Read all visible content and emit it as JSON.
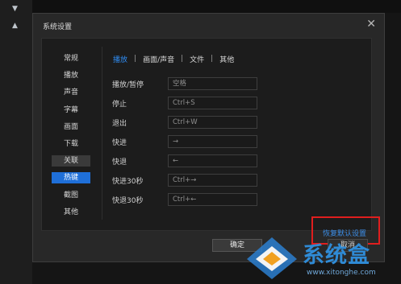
{
  "dialog": {
    "title": "系统设置",
    "close_glyph": "✕"
  },
  "nav": {
    "items": [
      {
        "label": "常规",
        "state": "normal"
      },
      {
        "label": "播放",
        "state": "normal"
      },
      {
        "label": "声音",
        "state": "normal"
      },
      {
        "label": "字幕",
        "state": "normal"
      },
      {
        "label": "画面",
        "state": "normal"
      },
      {
        "label": "下载",
        "state": "normal"
      },
      {
        "label": "关联",
        "state": "hover"
      },
      {
        "label": "热键",
        "state": "selected"
      },
      {
        "label": "截图",
        "state": "normal"
      },
      {
        "label": "其他",
        "state": "normal"
      }
    ]
  },
  "tabs": {
    "items": [
      "播放",
      "画面/声音",
      "文件",
      "其他"
    ],
    "separator": "|",
    "active": "播放"
  },
  "hotkeys": [
    {
      "label": "播放/暂停",
      "value": "空格"
    },
    {
      "label": "停止",
      "value": "Ctrl+S"
    },
    {
      "label": "退出",
      "value": "Ctrl+W"
    },
    {
      "label": "快进",
      "value": "→"
    },
    {
      "label": "快退",
      "value": "←"
    },
    {
      "label": "快进30秒",
      "value": "Ctrl+→"
    },
    {
      "label": "快退30秒",
      "value": "Ctrl+←"
    }
  ],
  "actions": {
    "restore_defaults": "恢复默认设置",
    "ok": "确定",
    "cancel": "取消"
  },
  "watermark": {
    "brand": "系统盒",
    "url": "www.xitonghe.com"
  },
  "colors": {
    "accent_blue": "#1f6fd8",
    "link_blue": "#3b8de6",
    "highlight_red": "#e01e1e",
    "dialog_bg": "#282828",
    "panel_bg": "#1c1c1c"
  }
}
